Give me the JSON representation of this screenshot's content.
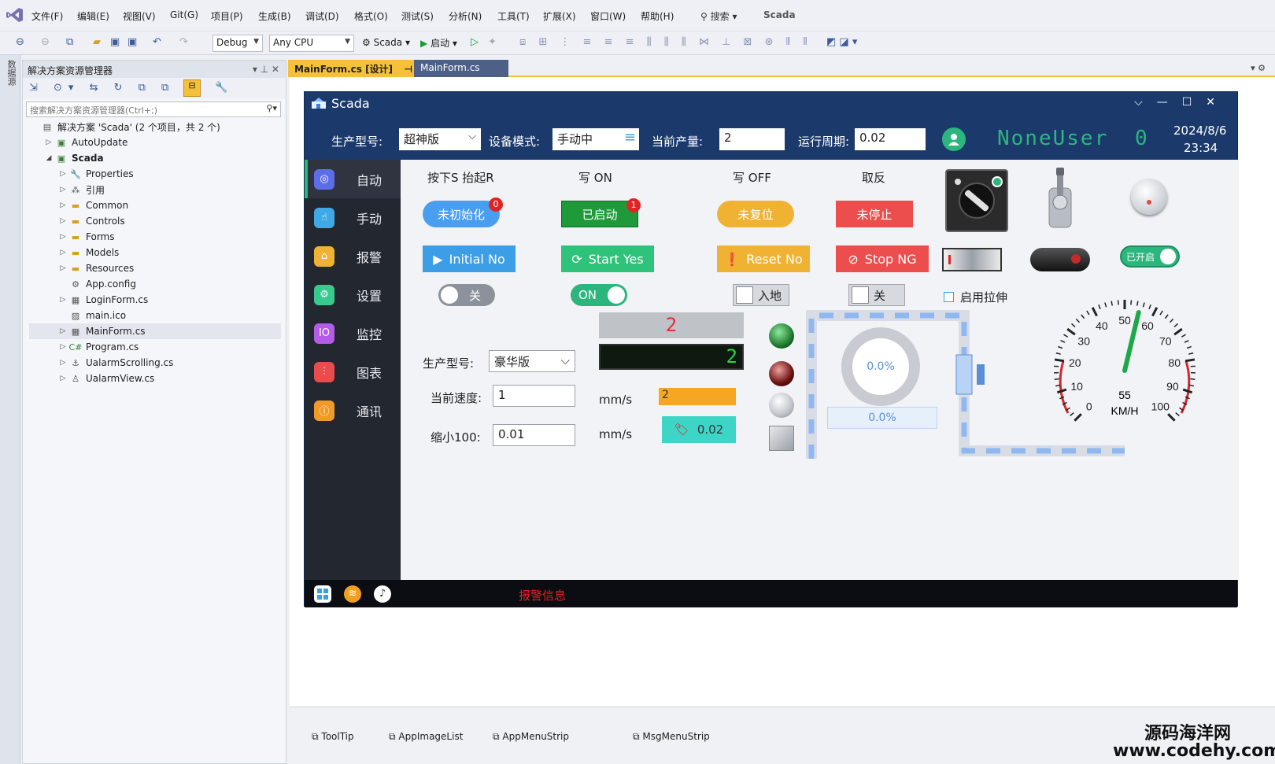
{
  "menu": [
    "文件(F)",
    "编辑(E)",
    "视图(V)",
    "Git(G)",
    "项目(P)",
    "生成(B)",
    "调试(D)",
    "格式(O)",
    "测试(S)",
    "分析(N)",
    "工具(T)",
    "扩展(X)",
    "窗口(W)",
    "帮助(H)"
  ],
  "search_label": "搜索",
  "solution_name": "Scada",
  "toolbar": {
    "config": "Debug",
    "platform": "Any CPU",
    "project": "Scada",
    "start": "启动"
  },
  "left_strip_label": "数据源",
  "solution_explorer": {
    "title": "解决方案资源管理器",
    "search_placeholder": "搜索解决方案资源管理器(Ctrl+;)",
    "tree": [
      {
        "label": "解决方案 'Scada' (2 个项目，共 2 个)",
        "icon": "solution-icon"
      },
      {
        "label": "AutoUpdate",
        "icon": "csharp-project-icon"
      },
      {
        "label": "Scada",
        "icon": "csharp-project-icon"
      },
      {
        "label": "Properties",
        "icon": "wrench-icon"
      },
      {
        "label": "引用",
        "icon": "references-icon"
      },
      {
        "label": "Common",
        "icon": "folder-icon"
      },
      {
        "label": "Controls",
        "icon": "folder-icon"
      },
      {
        "label": "Forms",
        "icon": "folder-icon"
      },
      {
        "label": "Models",
        "icon": "folder-icon"
      },
      {
        "label": "Resources",
        "icon": "folder-icon"
      },
      {
        "label": "App.config",
        "icon": "config-icon"
      },
      {
        "label": "LoginForm.cs",
        "icon": "form-icon"
      },
      {
        "label": "main.ico",
        "icon": "image-icon"
      },
      {
        "label": "MainForm.cs",
        "icon": "form-icon"
      },
      {
        "label": "Program.cs",
        "icon": "csharp-file-icon"
      },
      {
        "label": "UalarmScrolling.cs",
        "icon": "component-icon"
      },
      {
        "label": "UalarmView.cs",
        "icon": "usercontrol-icon"
      }
    ]
  },
  "tabs": [
    {
      "label": "MainForm.cs [设计]"
    },
    {
      "label": "MainForm.cs"
    }
  ],
  "scada": {
    "title": "Scada",
    "header": {
      "model_label": "生产型号:",
      "model_value": "超神版",
      "mode_label": "设备模式:",
      "mode_value": "手动中",
      "output_label": "当前产量:",
      "output_value": "2",
      "cycle_label": "运行周期:",
      "cycle_value": "0.02",
      "user": "NoneUser",
      "user_count": "0",
      "date": "2024/8/6",
      "time": "23:34"
    },
    "nav": [
      {
        "label": "自动",
        "icon": "auto-icon",
        "color": "#5b6ee8"
      },
      {
        "label": "手动",
        "icon": "hand-icon",
        "color": "#3fa8e6"
      },
      {
        "label": "报警",
        "icon": "alarm-icon",
        "color": "#f0b232"
      },
      {
        "label": "设置",
        "icon": "settings-icon",
        "color": "#38c98f"
      },
      {
        "label": "监控",
        "icon": "monitor-icon",
        "color": "#b45be8"
      },
      {
        "label": "图表",
        "icon": "chart-icon",
        "color": "#e84c4c"
      },
      {
        "label": "通讯",
        "icon": "comm-icon",
        "color": "#f09a28"
      }
    ],
    "columns": [
      "按下S 抬起R",
      "写 ON",
      "写 OFF",
      "取反"
    ],
    "pills": [
      {
        "label": "未初始化",
        "badge": "0",
        "color": "#4a9ef0"
      },
      {
        "label": "已启动",
        "badge": "1",
        "color": "#1f9a3a"
      },
      {
        "label": "未复位",
        "color": "#f0b232"
      },
      {
        "label": "未停止",
        "color": "#ec4d4d"
      }
    ],
    "buttons": [
      {
        "label": "Initial No",
        "icon": "play-icon",
        "color": "#3d9ee8"
      },
      {
        "label": "Start Yes",
        "icon": "refresh-icon",
        "color": "#2fc27a"
      },
      {
        "label": "Reset No",
        "icon": "warning-icon",
        "color": "#f0b232"
      },
      {
        "label": "Stop NG",
        "icon": "ban-icon",
        "color": "#ec4d4d"
      }
    ],
    "toggles": {
      "off": "关",
      "on": "ON",
      "check1": "入地",
      "check2": "关",
      "stretch": "启用拉伸",
      "switch_on": "已开启"
    },
    "led_red": "2",
    "led_green": "2",
    "model2_label": "生产型号:",
    "model2_value": "豪华版",
    "speed_label": "当前速度:",
    "speed_value": "1",
    "speed_unit": "mm/s",
    "scale_label": "缩小100:",
    "scale_value": "0.01",
    "scale_unit": "mm/s",
    "orange_value": "2",
    "tag_value": "0.02",
    "ring_pct": "0.0%",
    "ring_box_pct": "0.0%",
    "gauge": {
      "ticks": [
        "0",
        "10",
        "20",
        "30",
        "40",
        "50",
        "60",
        "70",
        "80",
        "90",
        "100"
      ],
      "value": "55",
      "value_num": 55,
      "unit": "KM/H"
    },
    "alarm_text": "报警信息",
    "colors": {
      "form_bg": "#1b3a6b",
      "nav_bg": "#23272f",
      "user_green": "#2cb67d"
    }
  },
  "tray": [
    "ToolTip",
    "AppImageList",
    "AppMenuStrip",
    "MsgMenuStrip"
  ],
  "watermark": {
    "line1": "源码海洋网",
    "line2": "www.codehy.com"
  }
}
